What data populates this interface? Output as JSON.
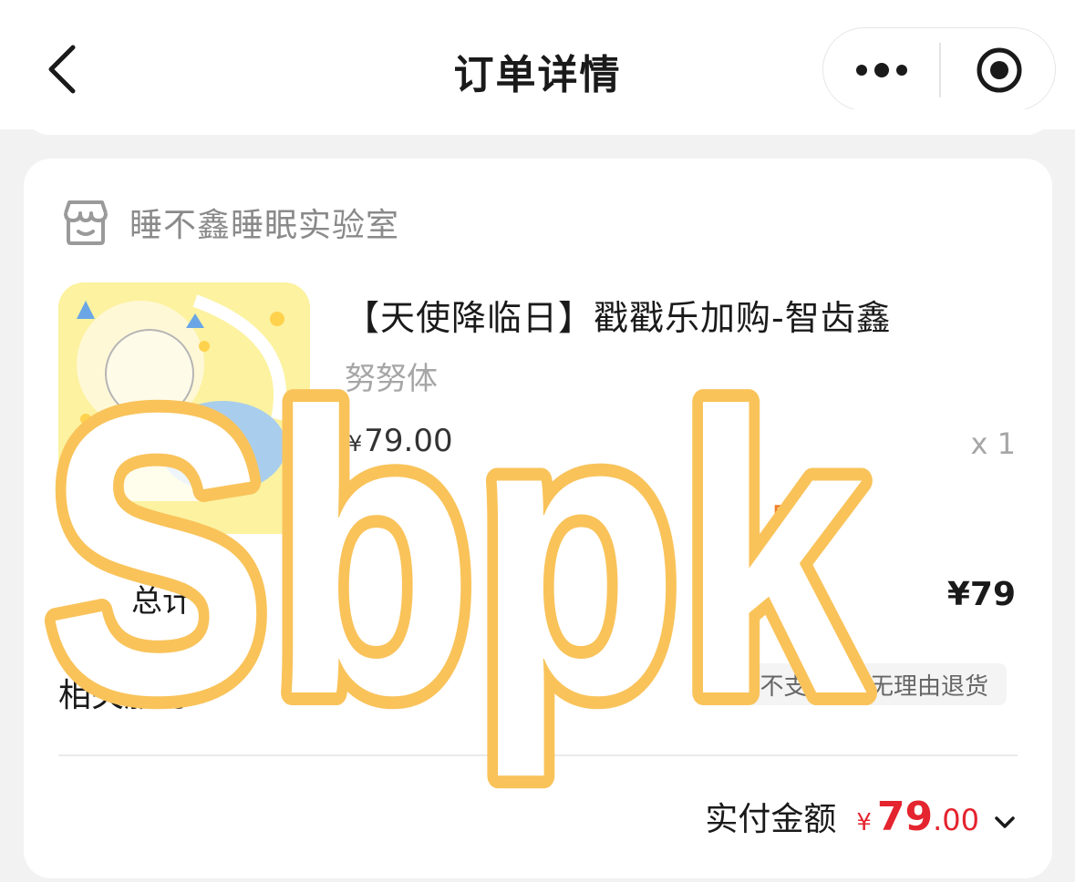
{
  "nav": {
    "title": "订单详情",
    "back_icon": "chevron-left-icon",
    "more_icon": "more-dots-icon",
    "target_icon": "record-target-icon"
  },
  "shop": {
    "icon": "store-icon",
    "name": "睡不鑫睡眠实验室"
  },
  "product": {
    "title": "【天使降临日】戳戳乐加购-智齿鑫",
    "spec": "努努体",
    "price_symbol": "¥",
    "price": "79.00",
    "quantity": "x 1",
    "deadline_fragment": "59前"
  },
  "summary": {
    "total_label": "总计",
    "total_value": "¥79",
    "service_label": "相关服务",
    "service_tag": "不支持7天无理由退货"
  },
  "payment": {
    "label": "实付金额",
    "symbol": "¥",
    "integer": "79",
    "decimal": ".00",
    "expand_icon": "chevron-down-icon"
  },
  "watermark": {
    "text": "Sbpk",
    "color": "#f9c35a"
  },
  "colors": {
    "accent_red": "#e4242e",
    "deadline_orange": "#f0802a",
    "page_bg": "#f2f2f2"
  }
}
